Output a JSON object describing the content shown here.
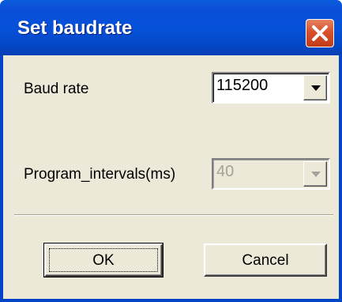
{
  "dialog": {
    "title": "Set baudrate",
    "close_icon": "close-icon",
    "accent_color": "#0a4ed8",
    "close_color": "#d6502c"
  },
  "baud_rate": {
    "label": "Baud rate",
    "value": "115200",
    "enabled": true
  },
  "program_intervals": {
    "label": "Program_intervals(ms)",
    "value": "40",
    "enabled": false
  },
  "buttons": {
    "ok_label": "OK",
    "cancel_label": "Cancel"
  }
}
